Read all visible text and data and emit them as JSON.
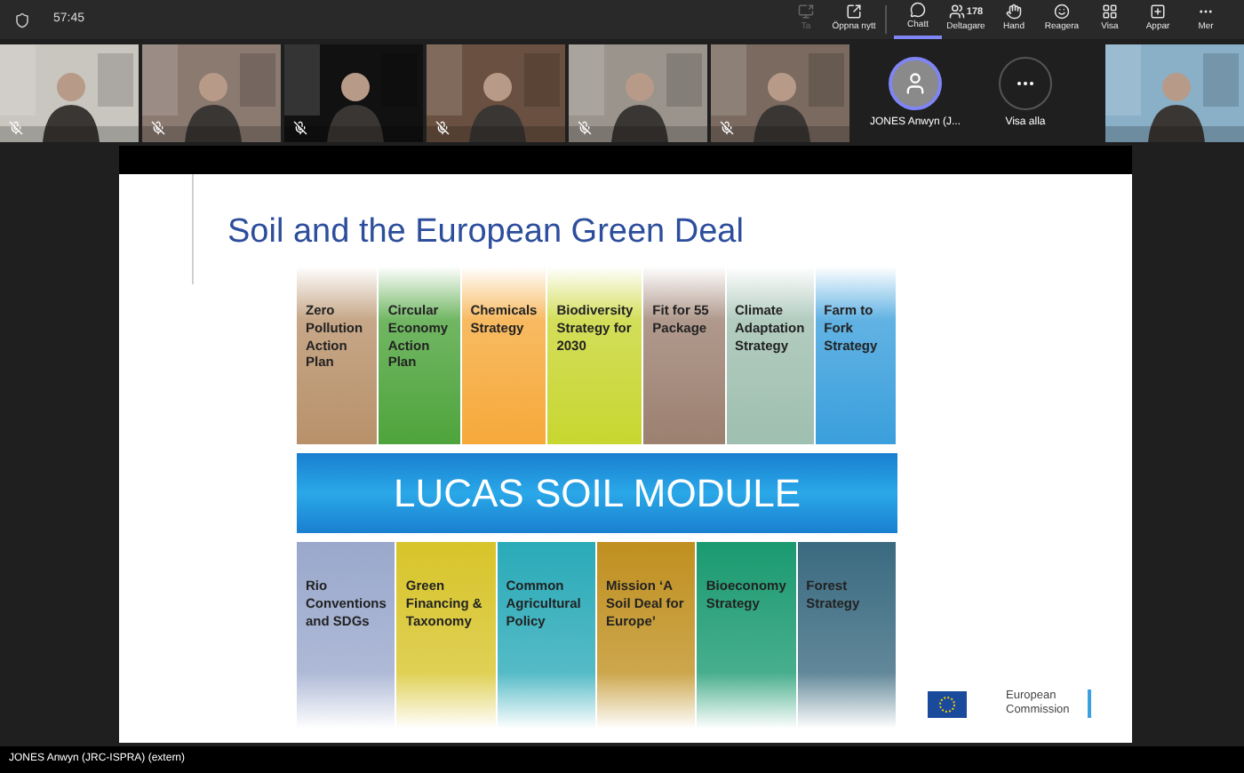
{
  "top_bar": {
    "timer": "57:45",
    "actions": [
      {
        "kind": "share",
        "label": "Ta",
        "disabled": true,
        "selected": false
      },
      {
        "kind": "popout",
        "label": "Öppna nytt",
        "disabled": false,
        "selected": false
      },
      {
        "kind": "chat",
        "label": "Chatt",
        "disabled": false,
        "selected": true
      },
      {
        "kind": "people",
        "label": "Deltagare",
        "badge": "178",
        "disabled": false,
        "selected": false
      },
      {
        "kind": "hand",
        "label": "Hand",
        "disabled": false,
        "selected": false
      },
      {
        "kind": "react",
        "label": "Reagera",
        "disabled": false,
        "selected": false
      },
      {
        "kind": "view",
        "label": "Visa",
        "disabled": false,
        "selected": false
      },
      {
        "kind": "apps",
        "label": "Appar",
        "disabled": false,
        "selected": false
      },
      {
        "kind": "more",
        "label": "Mer",
        "disabled": false,
        "selected": false
      }
    ]
  },
  "tiles": [
    {
      "kind": "video",
      "muted": true,
      "color": "#c9c6c0"
    },
    {
      "kind": "video",
      "muted": true,
      "color": "#8a7a70"
    },
    {
      "kind": "video",
      "muted": true,
      "color": "#111111"
    },
    {
      "kind": "video",
      "muted": true,
      "color": "#6a5040"
    },
    {
      "kind": "video",
      "muted": true,
      "color": "#9a948c"
    },
    {
      "kind": "video",
      "muted": true,
      "color": "#7a6a60"
    },
    {
      "kind": "avatar",
      "label": "JONES Anwyn (J..."
    },
    {
      "kind": "more",
      "label": "Visa alla"
    },
    {
      "kind": "video",
      "color": "#8ab0c8"
    }
  ],
  "slide": {
    "title": "Soil and the European Green Deal",
    "top_items": [
      {
        "label": "Zero Pollution Action Plan",
        "color": "#b8916a"
      },
      {
        "label": "Circular Economy Action Plan",
        "color": "#4ea43c"
      },
      {
        "label": "Chemicals Strategy",
        "color": "#f6a93a"
      },
      {
        "label": "Biodiversity Strategy for 2030",
        "color": "#c8d630"
      },
      {
        "label": "Fit for 55 Package",
        "color": "#9c8070"
      },
      {
        "label": "Climate Adaptation Strategy",
        "color": "#9fbfb0"
      },
      {
        "label": "Farm to Fork Strategy",
        "color": "#3a9fdc"
      }
    ],
    "band": "LUCAS SOIL MODULE",
    "bottom_items": [
      {
        "label": "Rio Conventions and SDGs",
        "color": "#9aa8cc"
      },
      {
        "label": "Green Financing & Taxonomy",
        "color": "#d8c42a"
      },
      {
        "label": "Common Agricultural Policy",
        "color": "#2aaab8"
      },
      {
        "label": "Mission ‘A Soil Deal for Europe’",
        "color": "#c09020"
      },
      {
        "label": "Bioeconomy Strategy",
        "color": "#1a9a70"
      },
      {
        "label": "Forest Strategy",
        "color": "#3a6a80"
      }
    ],
    "logo_text": "European Commission"
  },
  "presenter": "JONES Anwyn (JRC-ISPRA) (extern)"
}
